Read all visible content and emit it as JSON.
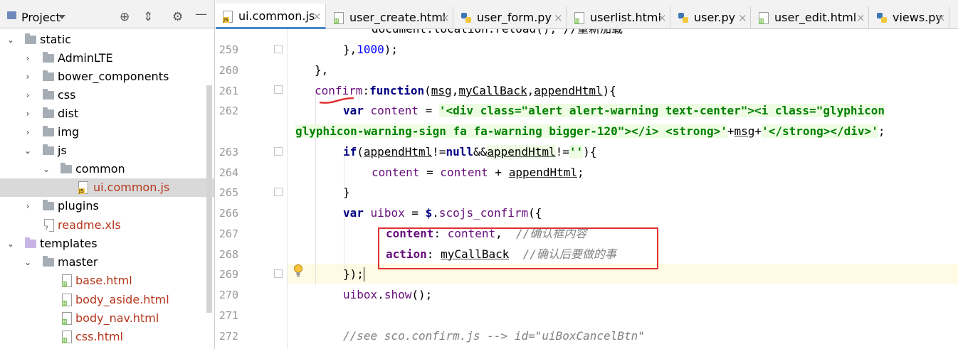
{
  "project_panel": {
    "title": "Project",
    "tree": [
      {
        "label": "static",
        "type": "folder",
        "expanded": true,
        "depth": 0
      },
      {
        "label": "AdminLTE",
        "type": "folder",
        "expanded": false,
        "depth": 1
      },
      {
        "label": "bower_components",
        "type": "folder",
        "expanded": false,
        "depth": 1
      },
      {
        "label": "css",
        "type": "folder",
        "expanded": false,
        "depth": 1
      },
      {
        "label": "dist",
        "type": "folder",
        "expanded": false,
        "depth": 1
      },
      {
        "label": "img",
        "type": "folder",
        "expanded": false,
        "depth": 1
      },
      {
        "label": "js",
        "type": "folder",
        "expanded": true,
        "depth": 1
      },
      {
        "label": "common",
        "type": "folder",
        "expanded": true,
        "depth": 2
      },
      {
        "label": "ui.common.js",
        "type": "js-file",
        "depth": 3,
        "selected": true
      },
      {
        "label": "plugins",
        "type": "folder",
        "expanded": false,
        "depth": 1
      },
      {
        "label": "readme.xls",
        "type": "unknown-file",
        "depth": 1
      },
      {
        "label": "templates",
        "type": "folder-templates",
        "expanded": true,
        "depth": 0
      },
      {
        "label": "master",
        "type": "folder",
        "expanded": true,
        "depth": 1
      },
      {
        "label": "base.html",
        "type": "html-file",
        "depth": 2
      },
      {
        "label": "body_aside.html",
        "type": "html-file",
        "depth": 2
      },
      {
        "label": "body_nav.html",
        "type": "html-file",
        "depth": 2
      },
      {
        "label": "css.html",
        "type": "html-file",
        "depth": 2
      }
    ]
  },
  "tabs": [
    {
      "label": "ui.common.js",
      "icon": "js-file-icon",
      "active": true
    },
    {
      "label": "user_create.html",
      "icon": "html-file-icon",
      "active": false
    },
    {
      "label": "user_form.py",
      "icon": "python-file-icon",
      "active": false
    },
    {
      "label": "userlist.html",
      "icon": "html-file-icon",
      "active": false
    },
    {
      "label": "user.py",
      "icon": "python-file-icon",
      "active": false
    },
    {
      "label": "user_edit.html",
      "icon": "html-file-icon",
      "active": false
    },
    {
      "label": "views.py",
      "icon": "python-file-icon",
      "active": false
    }
  ],
  "tab_close_glyph": "×",
  "editor": {
    "line_numbers": [
      "259",
      "260",
      "261",
      "262",
      "263",
      "264",
      "265",
      "266",
      "267",
      "268",
      "269",
      "270",
      "271",
      "272"
    ],
    "lines": {
      "l258": "document.location.reload(); //重新加载",
      "l259_a": "},",
      "l259_num": "1000",
      "l259_b": ");",
      "l260": "},",
      "l261_name": "confirm",
      "l261_colon": ":",
      "l261_kw": "function",
      "l261_p1": "(",
      "l261_msg": "msg",
      "l261_c1": ",",
      "l261_cb": "myCallBack",
      "l261_c2": ",",
      "l261_ah": "appendHtml",
      "l261_p2": "){",
      "l262_kw": "var",
      "l262_var": "content",
      "l262_eq": " = ",
      "l262_str": "'<div class=\"alert alert-warning text-center\"><i class=\"glyphicon",
      "l262_str2": "glyphicon-warning-sign fa fa-warning bigger-120\"></i> <strong>'",
      "l262_plus1": "+",
      "l262_msg": "msg",
      "l262_plus2": "+",
      "l262_str3": "'</strong></div>'",
      "l262_end": ";",
      "l263_kw": "if",
      "l263_p1": "(",
      "l263_ah": "appendHtml",
      "l263_op": "!=",
      "l263_null": "null",
      "l263_and": "&&",
      "l263_ah2": "appendHtml",
      "l263_op2": "!=",
      "l263_str": "''",
      "l263_p2": "){",
      "l264_a": "content",
      "l264_eq": " = ",
      "l264_b": "content",
      "l264_plus": " + ",
      "l264_c": "appendHtml",
      "l264_end": ";",
      "l265": "}",
      "l266_kw": "var",
      "l266_var": "uibox",
      "l266_eq": " = ",
      "l266_dollar": "$",
      "l266_dot": ".",
      "l266_fn": "scojs_confirm",
      "l266_p": "({",
      "l267_key": "content",
      "l267_colon": ": ",
      "l267_val": "content",
      "l267_comma": ",",
      "l267_cmt": "  //确认框内容",
      "l268_key": "action",
      "l268_colon": ": ",
      "l268_val": "myCallBack",
      "l268_cmt": "  //确认后要做的事",
      "l269": "});",
      "l270_obj": "uibox",
      "l270_dot": ".",
      "l270_fn": "show",
      "l270_end": "();",
      "l272": "//see sco.confirm.js --> id=\"uiBoxCancelBtn\""
    }
  },
  "colors": {
    "keyword": "#000080",
    "field": "#660e7a",
    "string": "#008000",
    "comment": "#808080",
    "number": "#0000ff",
    "annotation_box": "#e03131",
    "current_line": "#fffae3",
    "active_tab_underline": "#4a88c7"
  }
}
